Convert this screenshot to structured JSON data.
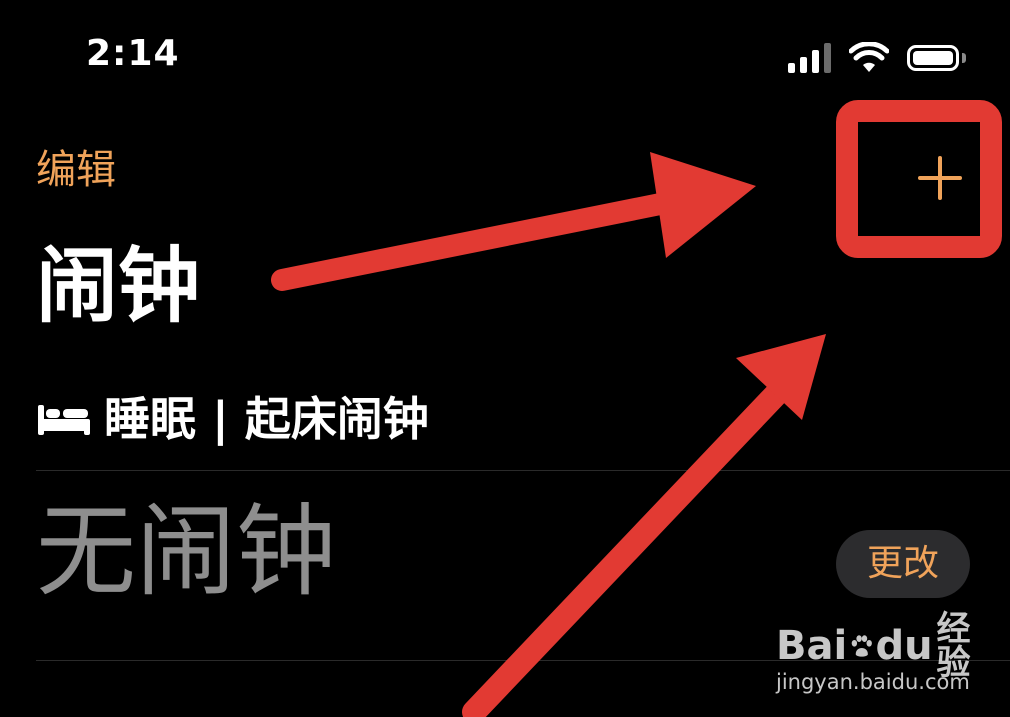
{
  "status_bar": {
    "time": "2:14",
    "signal_icon": "cellular-signal-icon",
    "wifi_icon": "wifi-icon",
    "battery_icon": "battery-icon"
  },
  "nav": {
    "edit_label": "编辑",
    "add_label": "+",
    "add_icon": "plus-icon"
  },
  "page": {
    "title": "闹钟"
  },
  "sleep": {
    "icon": "bed-icon",
    "label": "睡眠 | 起床闹钟"
  },
  "alarm": {
    "empty_label": "无闹钟",
    "change_label": "更改"
  },
  "annotation": {
    "color": "#e23a33"
  },
  "watermark": {
    "brand_left": "Bai",
    "brand_right": "du",
    "brand_cn": "经验",
    "url": "jingyan.baidu.com"
  },
  "colors": {
    "accent": "#f0a35a",
    "background": "#000000",
    "secondary_text": "#8e8e8e",
    "button_bg": "#2c2c2e"
  }
}
